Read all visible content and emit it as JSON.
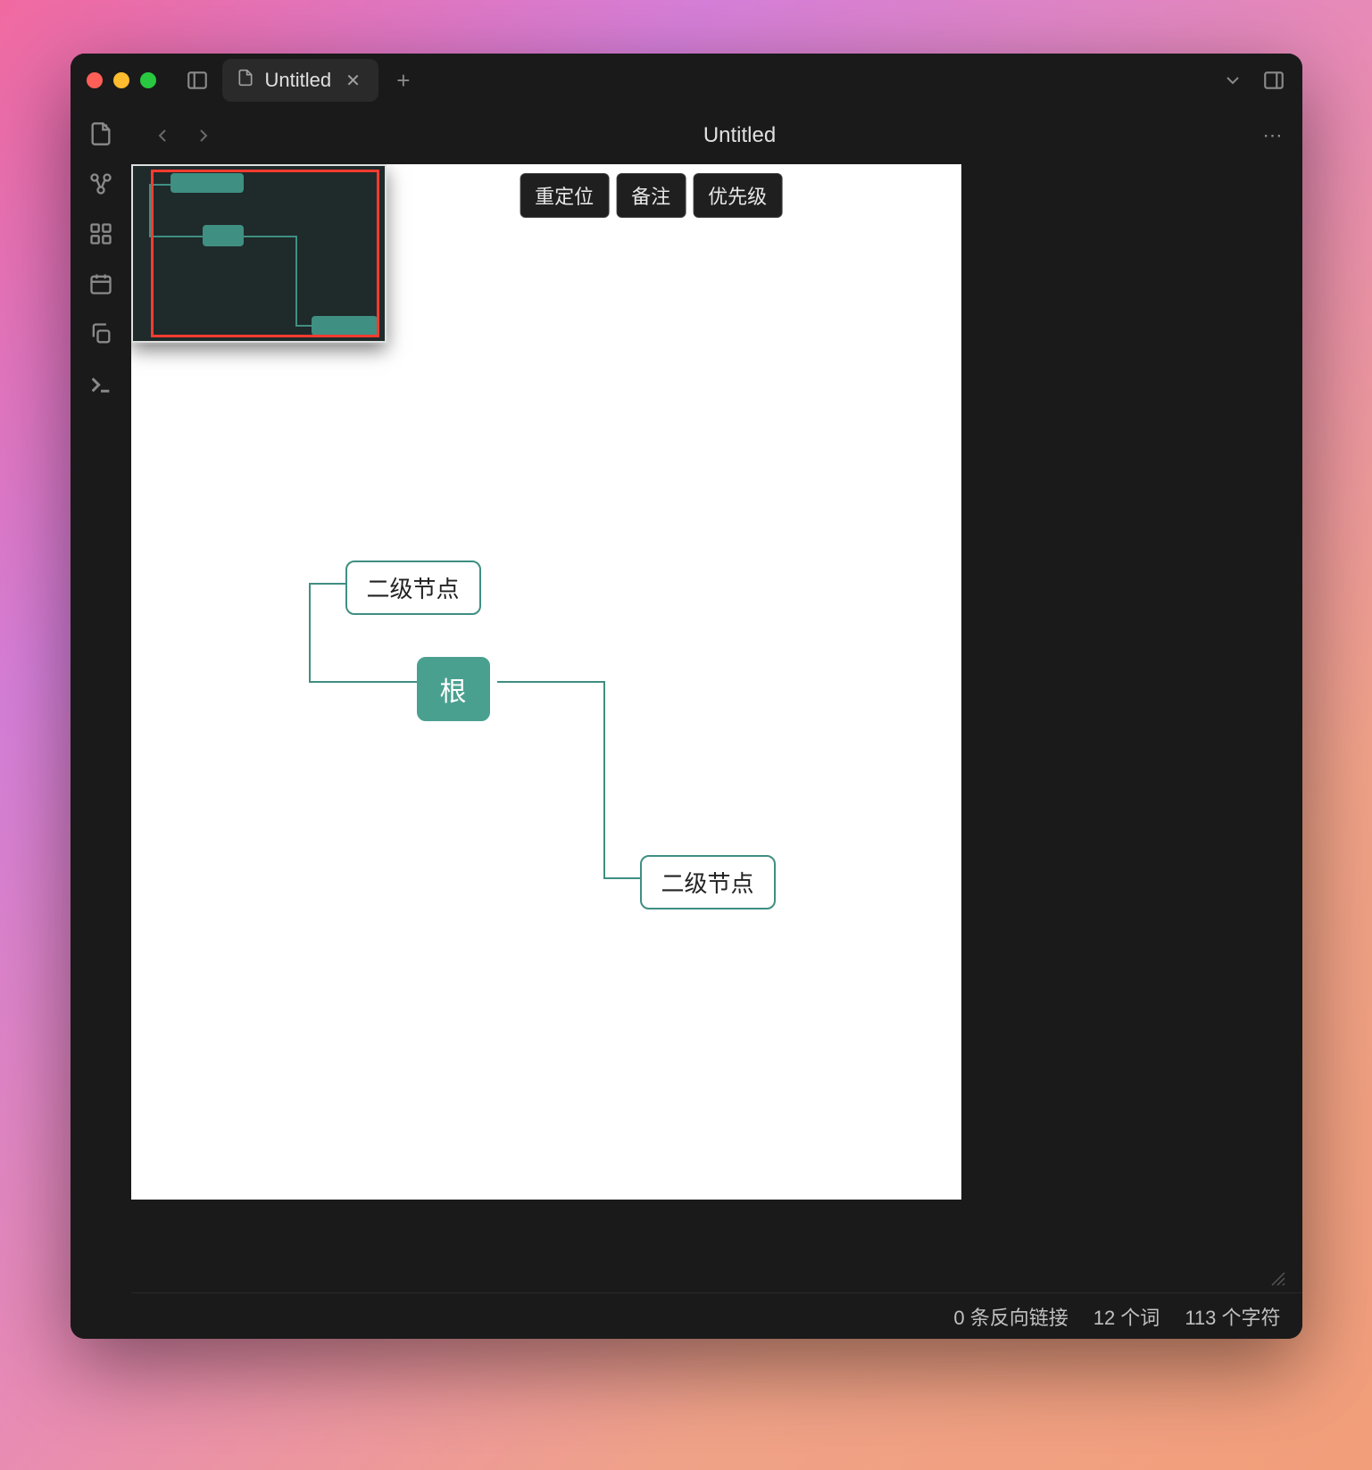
{
  "tab": {
    "title": "Untitled"
  },
  "document": {
    "title": "Untitled"
  },
  "toolbar": {
    "relocate": "重定位",
    "note": "备注",
    "priority": "优先级"
  },
  "mindmap": {
    "root": "根",
    "child1": "二级节点",
    "child2": "二级节点"
  },
  "status": {
    "backlinks": "0 条反向链接",
    "words": "12 个词",
    "chars": "113 个字符"
  },
  "colors": {
    "accent": "#4aa08f",
    "border": "#3f8f82"
  }
}
